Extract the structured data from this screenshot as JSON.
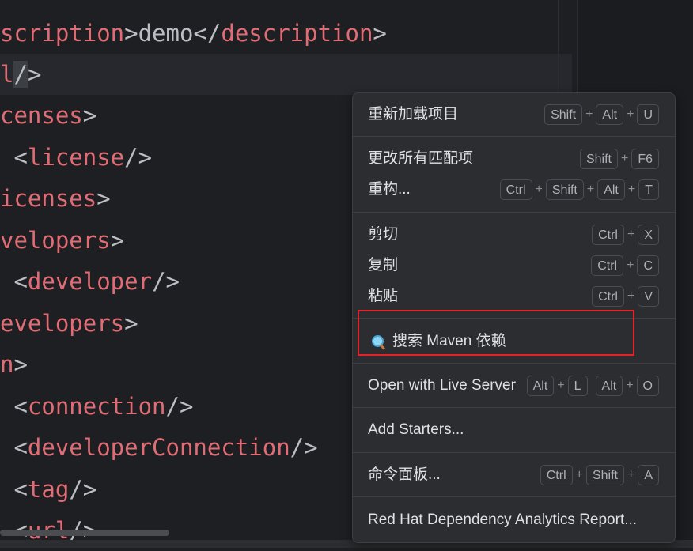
{
  "editor": {
    "lines": [
      {
        "pre": "",
        "tag": "scription",
        "mid": ">demo</",
        "tag2": "description",
        "post": ">"
      },
      {
        "pre": "",
        "tag": "l",
        "mid": "",
        "tag2": "",
        "post": "/>"
      },
      {
        "pre": "",
        "tag": "censes",
        "mid": "",
        "tag2": "",
        "post": ">"
      },
      {
        "pre": " <",
        "tag": "license",
        "mid": "",
        "tag2": "",
        "post": "/>"
      },
      {
        "pre": "",
        "tag": "icenses",
        "mid": "",
        "tag2": "",
        "post": ">"
      },
      {
        "pre": "",
        "tag": "velopers",
        "mid": "",
        "tag2": "",
        "post": ">"
      },
      {
        "pre": " <",
        "tag": "developer",
        "mid": "",
        "tag2": "",
        "post": "/>"
      },
      {
        "pre": "",
        "tag": "evelopers",
        "mid": "",
        "tag2": "",
        "post": ">"
      },
      {
        "pre": "",
        "tag": "n",
        "mid": "",
        "tag2": "",
        "post": ">"
      },
      {
        "pre": " <",
        "tag": "connection",
        "mid": "",
        "tag2": "",
        "post": "/>"
      },
      {
        "pre": " <",
        "tag": "developerConnection",
        "mid": "",
        "tag2": "",
        "post": "/>"
      },
      {
        "pre": " <",
        "tag": "tag",
        "mid": "",
        "tag2": "",
        "post": "/>"
      },
      {
        "pre": " <",
        "tag": "url",
        "mid": "",
        "tag2": "",
        "post": "/>"
      }
    ]
  },
  "menu": {
    "reload": {
      "label": "重新加载项目",
      "keys": [
        "Shift",
        "Alt",
        "U"
      ]
    },
    "change_all": {
      "label": "更改所有匹配项",
      "keys": [
        "Shift",
        "F6"
      ]
    },
    "refactor": {
      "label": "重构...",
      "keys": [
        "Ctrl",
        "Shift",
        "Alt",
        "T"
      ]
    },
    "cut": {
      "label": "剪切",
      "keys": [
        "Ctrl",
        "X"
      ]
    },
    "copy": {
      "label": "复制",
      "keys": [
        "Ctrl",
        "C"
      ]
    },
    "paste": {
      "label": "粘贴",
      "keys": [
        "Ctrl",
        "V"
      ]
    },
    "search_maven": {
      "label": "搜索 Maven 依赖",
      "icon": "search-icon"
    },
    "live_server": {
      "label": "Open with Live Server",
      "keys1": [
        "Alt",
        "L"
      ],
      "keys2": [
        "Alt",
        "O"
      ]
    },
    "add_starters": {
      "label": "Add Starters..."
    },
    "command_palette": {
      "label": "命令面板...",
      "keys": [
        "Ctrl",
        "Shift",
        "A"
      ]
    },
    "red_hat": {
      "label": "Red Hat Dependency Analytics Report..."
    }
  },
  "colors": {
    "tag": "#e06c75",
    "highlight_border": "#e5222a",
    "menu_bg": "#2b2d30",
    "editor_bg": "#1e1f22"
  }
}
